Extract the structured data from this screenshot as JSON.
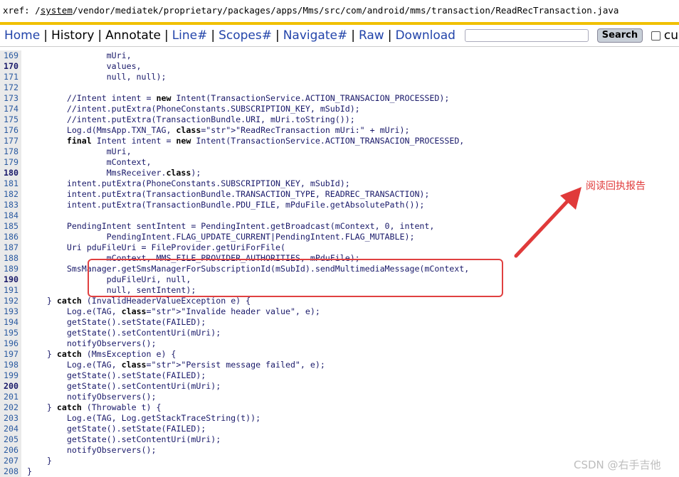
{
  "xref": {
    "prefix": "xref: /",
    "system": "system",
    "rest": "/vendor/mediatek/proprietary/packages/apps/Mms/src/com/android/mms/transaction/ReadRecTransaction.java"
  },
  "nav": {
    "home": "Home",
    "history": "History",
    "annotate": "Annotate",
    "line": "Line#",
    "scopes": "Scopes#",
    "navigate": "Navigate#",
    "raw": "Raw",
    "download": "Download",
    "search_button": "Search",
    "current_dir": "current dire",
    "search_placeholder": ""
  },
  "annotation": "阅读回执报告",
  "watermark": "CSDN @右手吉他",
  "colors": {
    "highlight_box": "#e04040",
    "annotation": "#e03a3a",
    "nav_link": "#2244aa",
    "accent_bar": "#f0c000"
  },
  "code_lines": [
    {
      "n": "169",
      "bold": false,
      "t": "                mUri,"
    },
    {
      "n": "170",
      "bold": true,
      "t": "                values,"
    },
    {
      "n": "171",
      "bold": false,
      "t": "                null, null);"
    },
    {
      "n": "172",
      "bold": false,
      "t": ""
    },
    {
      "n": "173",
      "bold": false,
      "t": "        //Intent intent = new Intent(TransactionService.ACTION_TRANSACION_PROCESSED);"
    },
    {
      "n": "174",
      "bold": false,
      "t": "        //intent.putExtra(PhoneConstants.SUBSCRIPTION_KEY, mSubId);"
    },
    {
      "n": "175",
      "bold": false,
      "t": "        //intent.putExtra(TransactionBundle.URI, mUri.toString());"
    },
    {
      "n": "176",
      "bold": false,
      "t": "        Log.d(MmsApp.TXN_TAG, \"ReadRecTransaction mUri:\" + mUri);"
    },
    {
      "n": "177",
      "bold": false,
      "t": "        final Intent intent = new Intent(TransactionService.ACTION_TRANSACION_PROCESSED,"
    },
    {
      "n": "178",
      "bold": false,
      "t": "                mUri,"
    },
    {
      "n": "179",
      "bold": false,
      "t": "                mContext,"
    },
    {
      "n": "180",
      "bold": true,
      "t": "                MmsReceiver.class);"
    },
    {
      "n": "181",
      "bold": false,
      "t": "        intent.putExtra(PhoneConstants.SUBSCRIPTION_KEY, mSubId);"
    },
    {
      "n": "182",
      "bold": false,
      "t": "        intent.putExtra(TransactionBundle.TRANSACTION_TYPE, READREC_TRANSACTION);"
    },
    {
      "n": "183",
      "bold": false,
      "t": "        intent.putExtra(TransactionBundle.PDU_FILE, mPduFile.getAbsolutePath());"
    },
    {
      "n": "184",
      "bold": false,
      "t": ""
    },
    {
      "n": "185",
      "bold": false,
      "t": "        PendingIntent sentIntent = PendingIntent.getBroadcast(mContext, 0, intent,"
    },
    {
      "n": "186",
      "bold": false,
      "t": "                PendingIntent.FLAG_UPDATE_CURRENT|PendingIntent.FLAG_MUTABLE);"
    },
    {
      "n": "187",
      "bold": false,
      "t": "        Uri pduFileUri = FileProvider.getUriForFile("
    },
    {
      "n": "188",
      "bold": false,
      "t": "                mContext, MMS_FILE_PROVIDER_AUTHORITIES, mPduFile);"
    },
    {
      "n": "189",
      "bold": false,
      "t": "        SmsManager.getSmsManagerForSubscriptionId(mSubId).sendMultimediaMessage(mContext,"
    },
    {
      "n": "190",
      "bold": true,
      "t": "                pduFileUri, null,"
    },
    {
      "n": "191",
      "bold": false,
      "t": "                null, sentIntent);"
    },
    {
      "n": "192",
      "bold": false,
      "t": "    } catch (InvalidHeaderValueException e) {"
    },
    {
      "n": "193",
      "bold": false,
      "t": "        Log.e(TAG, \"Invalide header value\", e);"
    },
    {
      "n": "194",
      "bold": false,
      "t": "        getState().setState(FAILED);"
    },
    {
      "n": "195",
      "bold": false,
      "t": "        getState().setContentUri(mUri);"
    },
    {
      "n": "196",
      "bold": false,
      "t": "        notifyObservers();"
    },
    {
      "n": "197",
      "bold": false,
      "t": "    } catch (MmsException e) {"
    },
    {
      "n": "198",
      "bold": false,
      "t": "        Log.e(TAG, \"Persist message failed\", e);"
    },
    {
      "n": "199",
      "bold": false,
      "t": "        getState().setState(FAILED);"
    },
    {
      "n": "200",
      "bold": true,
      "t": "        getState().setContentUri(mUri);"
    },
    {
      "n": "201",
      "bold": false,
      "t": "        notifyObservers();"
    },
    {
      "n": "202",
      "bold": false,
      "t": "    } catch (Throwable t) {"
    },
    {
      "n": "203",
      "bold": false,
      "t": "        Log.e(TAG, Log.getStackTraceString(t));"
    },
    {
      "n": "204",
      "bold": false,
      "t": "        getState().setState(FAILED);"
    },
    {
      "n": "205",
      "bold": false,
      "t": "        getState().setContentUri(mUri);"
    },
    {
      "n": "206",
      "bold": false,
      "t": "        notifyObservers();"
    },
    {
      "n": "207",
      "bold": false,
      "t": "    }"
    },
    {
      "n": "208",
      "bold": false,
      "t": "}"
    }
  ]
}
